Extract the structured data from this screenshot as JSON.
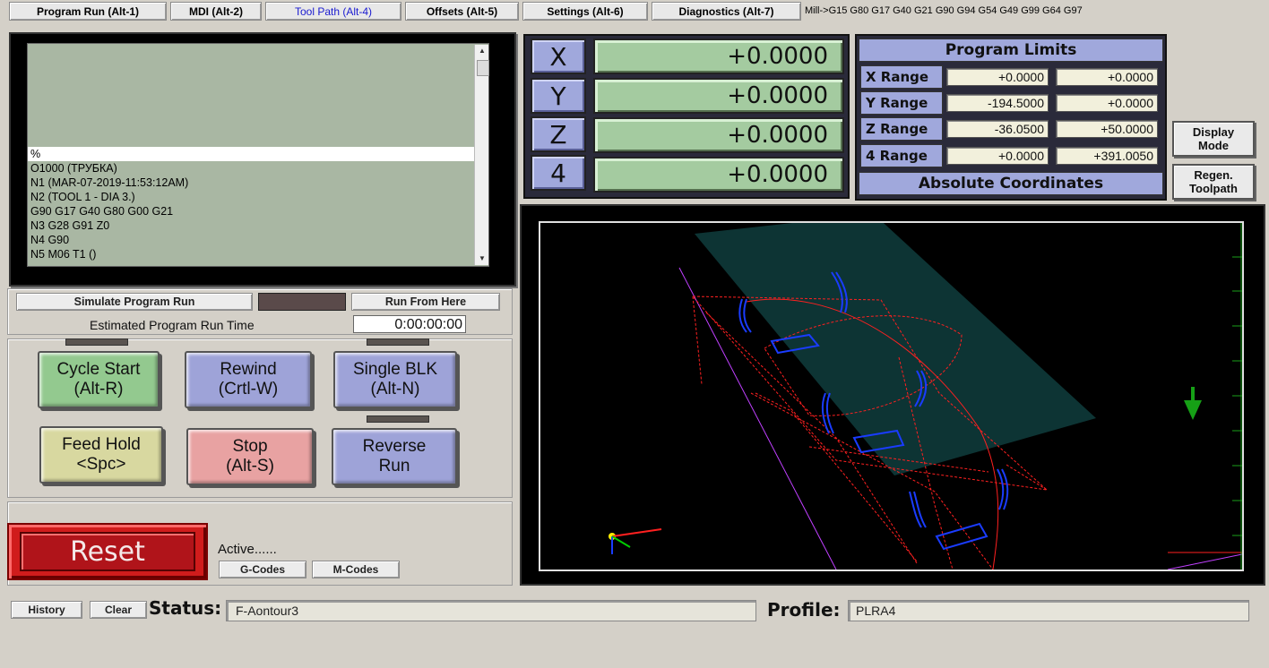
{
  "tabs": [
    {
      "label": "Program Run (Alt-1)",
      "active": false
    },
    {
      "label": "MDI (Alt-2)",
      "active": false
    },
    {
      "label": "Tool Path (Alt-4)",
      "active": true
    },
    {
      "label": "Offsets (Alt-5)",
      "active": false
    },
    {
      "label": "Settings (Alt-6)",
      "active": false
    },
    {
      "label": "Diagnostics (Alt-7)",
      "active": false
    }
  ],
  "modal_status": "Mill->G15  G80 G17 G40 G21 G90 G94 G54 G49 G99 G64 G97",
  "gcode": {
    "lines": [
      "%",
      "O1000 (ТРУБКА)",
      "N1 (MAR-07-2019-11:53:12AM)",
      "N2 (TOOL 1 - DIA 3.)",
      "G90 G17 G40 G80 G00 G21",
      "N3 G28 G91 Z0",
      "N4 G90",
      "N5 M06 T1 ()"
    ],
    "highlight_index": 0
  },
  "run": {
    "simulate_label": "Simulate Program Run",
    "run_from_here_label": "Run From Here",
    "est_time_label": "Estimated Program Run Time",
    "est_time_value": "0:00:00:00"
  },
  "controls": {
    "cycle_start": [
      "Cycle Start",
      "(Alt-R)"
    ],
    "rewind": [
      "Rewind",
      "(Crtl-W)"
    ],
    "single_blk": [
      "Single BLK",
      "(Alt-N)"
    ],
    "feed_hold": [
      "Feed Hold",
      "<Spc>"
    ],
    "stop": [
      "Stop",
      "(Alt-S)"
    ],
    "reverse_run": [
      "Reverse",
      "Run"
    ]
  },
  "dro": [
    {
      "axis": "X",
      "value": "+0.0000"
    },
    {
      "axis": "Y",
      "value": "+0.0000"
    },
    {
      "axis": "Z",
      "value": "+0.0000"
    },
    {
      "axis": "4",
      "value": "+0.0000"
    }
  ],
  "limits": {
    "title": "Program Limits",
    "rows": [
      {
        "label": "X Range",
        "min": "+0.0000",
        "max": "+0.0000"
      },
      {
        "label": "Y Range",
        "min": "-194.5000",
        "max": "+0.0000"
      },
      {
        "label": "Z Range",
        "min": "-36.0500",
        "max": "+50.0000"
      },
      {
        "label": "4 Range",
        "min": "+0.0000",
        "max": "+391.0050"
      }
    ],
    "footer": "Absolute Coordinates"
  },
  "side_buttons": {
    "display_mode": [
      "Display",
      "Mode"
    ],
    "regen_toolpath": [
      "Regen.",
      "Toolpath"
    ]
  },
  "reset": {
    "label": "Reset"
  },
  "active": {
    "label": "Active......",
    "gcodes": "G-Codes",
    "mcodes": "M-Codes"
  },
  "bottom": {
    "history": "History",
    "clear": "Clear",
    "status_label": "Status:",
    "status_value": "F-Aontour3",
    "profile_label": "Profile:",
    "profile_value": "PLRA4"
  },
  "colors": {
    "dro_green": "#a4cba0",
    "axis_blue": "#a0a8dc",
    "cycle_start": "#93c98f",
    "rewind": "#9ea3d8",
    "single_blk": "#9ea3d8",
    "feed_hold": "#d8d8a0",
    "stop": "#e8a2a2",
    "reverse_run": "#9ea3d8",
    "reset": "#d01c1c",
    "toolpath_red": "#ff2020",
    "toolpath_blue": "#1a3cff"
  }
}
